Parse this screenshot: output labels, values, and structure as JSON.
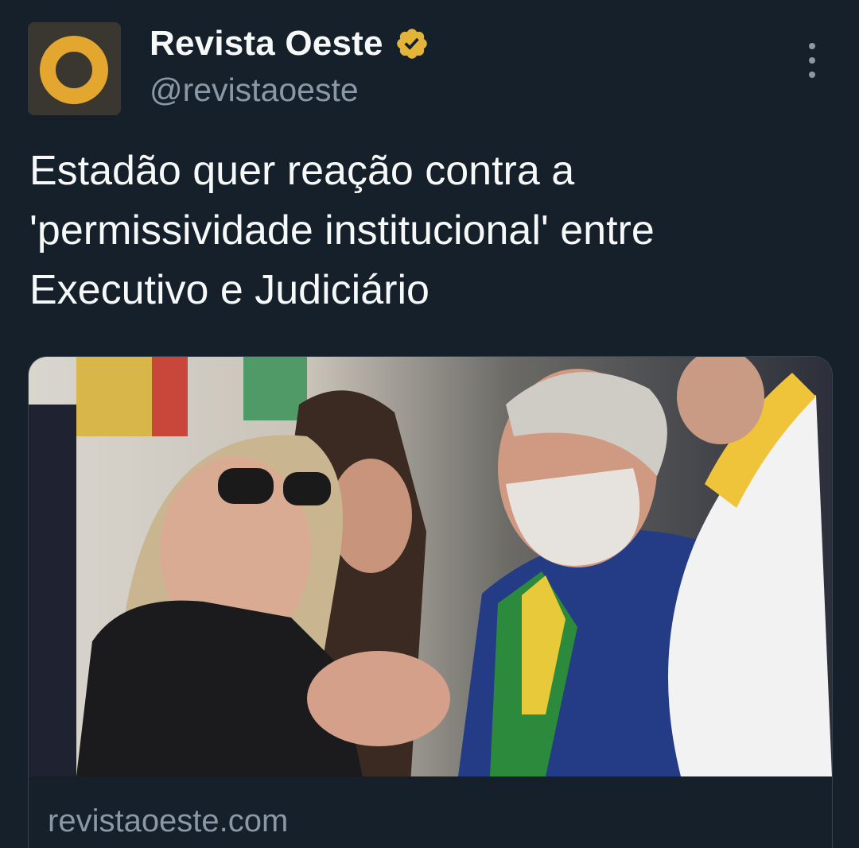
{
  "account": {
    "display_name": "Revista Oeste",
    "handle": "@revistaoeste",
    "verified": true,
    "avatar_icon": "revista-oeste-logo-icon",
    "verified_icon": "verified-badge-icon",
    "brand_color": "#e3a72f"
  },
  "tweet": {
    "text": "Estadão quer reação contra a\n'permissividade institucional' entre\nExecutivo e Judiciário"
  },
  "card": {
    "image_alt": "",
    "domain": "revistaoeste.com"
  },
  "menu": {
    "icon": "more-options-icon"
  },
  "colors": {
    "background": "#15202b",
    "primary_text": "#f7f9f9",
    "secondary_text": "#8b98a5",
    "verified_gold": "#e3b43a"
  }
}
